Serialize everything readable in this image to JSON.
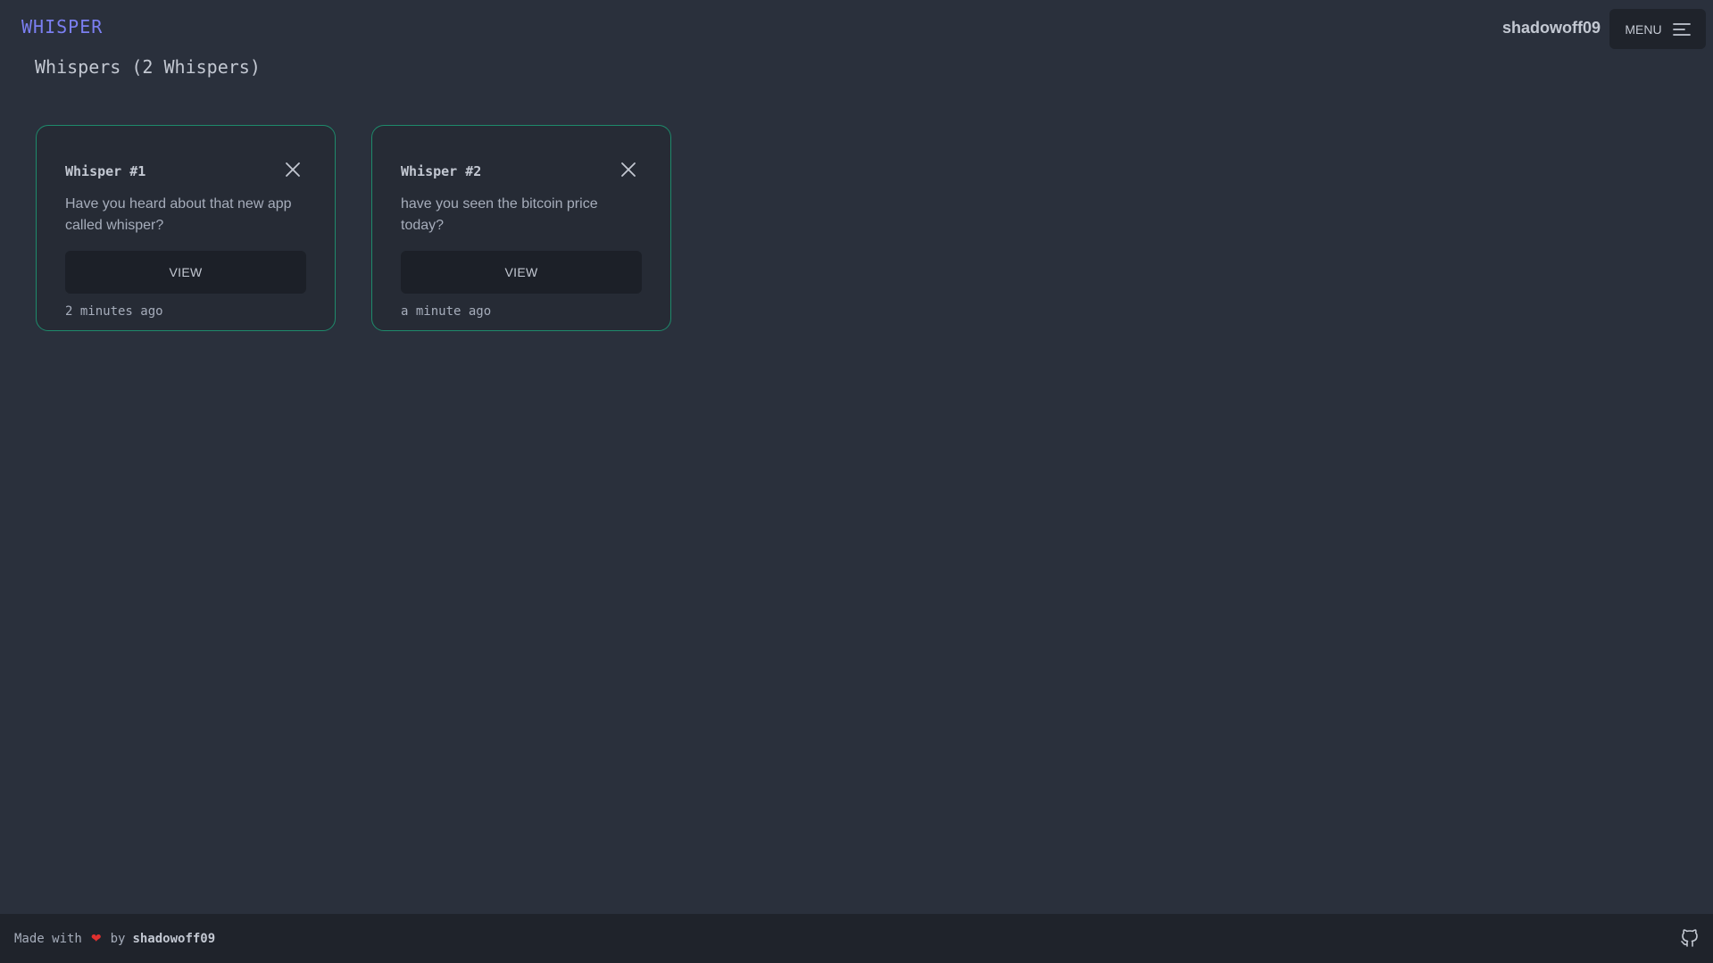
{
  "header": {
    "brand": "WHISPER",
    "username": "shadowoff09",
    "menu_label": "MENU"
  },
  "page": {
    "title": "Whispers (2 Whispers)"
  },
  "whispers": [
    {
      "title": "Whisper #1",
      "body": "Have you heard about that new app called whisper?",
      "view_label": "VIEW",
      "time": "2 minutes ago"
    },
    {
      "title": "Whisper #2",
      "body": "have you seen the bitcoin price today?",
      "view_label": "VIEW",
      "time": "a minute ago"
    }
  ],
  "footer": {
    "made_with": "Made with",
    "by": "by",
    "author": "shadowoff09"
  },
  "colors": {
    "background": "#2a303c",
    "brand": "#7b7ff2",
    "card_border": "#1e8a6b",
    "footer": "#1f232b",
    "heart": "#e0302f"
  },
  "icons": {
    "menu": "menu-icon",
    "close": "close-icon",
    "heart": "heart-icon",
    "github": "github-icon"
  }
}
